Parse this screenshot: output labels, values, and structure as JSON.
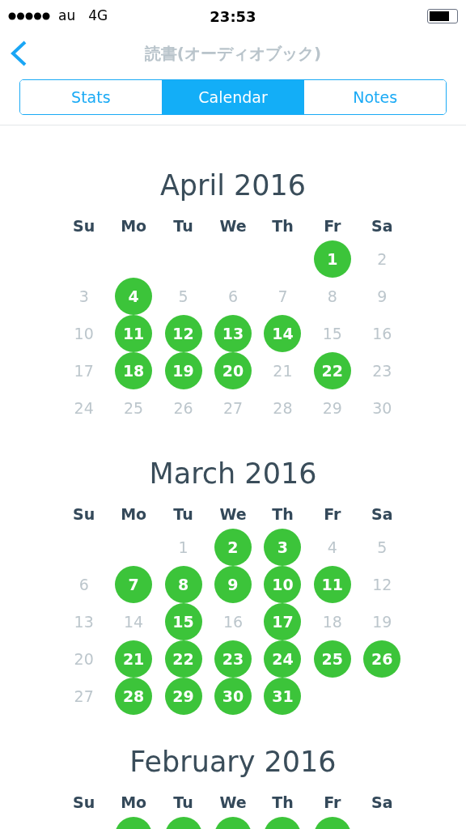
{
  "status_bar": {
    "carrier": "au",
    "network": "4G",
    "time": "23:53"
  },
  "nav": {
    "title": "読書(オーディオブック)"
  },
  "tabs": [
    {
      "label": "Stats",
      "selected": false
    },
    {
      "label": "Calendar",
      "selected": true
    },
    {
      "label": "Notes",
      "selected": false
    }
  ],
  "months": [
    {
      "title": "April 2016",
      "weekdays": [
        "Su",
        "Mo",
        "Tu",
        "We",
        "Th",
        "Fr",
        "Sa"
      ],
      "weeks": [
        [
          {
            "kind": "blank"
          },
          {
            "kind": "blank"
          },
          {
            "kind": "blank"
          },
          {
            "kind": "blank"
          },
          {
            "kind": "blank"
          },
          {
            "kind": "day",
            "day": "1",
            "marked": true
          },
          {
            "kind": "day",
            "day": "2",
            "marked": false
          }
        ],
        [
          {
            "kind": "day",
            "day": "3",
            "marked": false
          },
          {
            "kind": "day",
            "day": "4",
            "marked": true
          },
          {
            "kind": "day",
            "day": "5",
            "marked": false
          },
          {
            "kind": "day",
            "day": "6",
            "marked": false
          },
          {
            "kind": "day",
            "day": "7",
            "marked": false
          },
          {
            "kind": "day",
            "day": "8",
            "marked": false
          },
          {
            "kind": "day",
            "day": "9",
            "marked": false
          }
        ],
        [
          {
            "kind": "day",
            "day": "10",
            "marked": false
          },
          {
            "kind": "day",
            "day": "11",
            "marked": true
          },
          {
            "kind": "day",
            "day": "12",
            "marked": true
          },
          {
            "kind": "day",
            "day": "13",
            "marked": true
          },
          {
            "kind": "day",
            "day": "14",
            "marked": true
          },
          {
            "kind": "day",
            "day": "15",
            "marked": false
          },
          {
            "kind": "day",
            "day": "16",
            "marked": false
          }
        ],
        [
          {
            "kind": "day",
            "day": "17",
            "marked": false
          },
          {
            "kind": "day",
            "day": "18",
            "marked": true
          },
          {
            "kind": "day",
            "day": "19",
            "marked": true
          },
          {
            "kind": "day",
            "day": "20",
            "marked": true
          },
          {
            "kind": "day",
            "day": "21",
            "marked": false
          },
          {
            "kind": "day",
            "day": "22",
            "marked": true
          },
          {
            "kind": "day",
            "day": "23",
            "marked": false
          }
        ],
        [
          {
            "kind": "day",
            "day": "24",
            "marked": false
          },
          {
            "kind": "day",
            "day": "25",
            "marked": false
          },
          {
            "kind": "day",
            "day": "26",
            "marked": false
          },
          {
            "kind": "day",
            "day": "27",
            "marked": false
          },
          {
            "kind": "day",
            "day": "28",
            "marked": false
          },
          {
            "kind": "day",
            "day": "29",
            "marked": false
          },
          {
            "kind": "day",
            "day": "30",
            "marked": false
          }
        ]
      ]
    },
    {
      "title": "March 2016",
      "weekdays": [
        "Su",
        "Mo",
        "Tu",
        "We",
        "Th",
        "Fr",
        "Sa"
      ],
      "weeks": [
        [
          {
            "kind": "blank"
          },
          {
            "kind": "blank"
          },
          {
            "kind": "day",
            "day": "1",
            "marked": false
          },
          {
            "kind": "day",
            "day": "2",
            "marked": true
          },
          {
            "kind": "day",
            "day": "3",
            "marked": true
          },
          {
            "kind": "day",
            "day": "4",
            "marked": false
          },
          {
            "kind": "day",
            "day": "5",
            "marked": false
          }
        ],
        [
          {
            "kind": "day",
            "day": "6",
            "marked": false
          },
          {
            "kind": "day",
            "day": "7",
            "marked": true
          },
          {
            "kind": "day",
            "day": "8",
            "marked": true
          },
          {
            "kind": "day",
            "day": "9",
            "marked": true
          },
          {
            "kind": "day",
            "day": "10",
            "marked": true
          },
          {
            "kind": "day",
            "day": "11",
            "marked": true
          },
          {
            "kind": "day",
            "day": "12",
            "marked": false
          }
        ],
        [
          {
            "kind": "day",
            "day": "13",
            "marked": false
          },
          {
            "kind": "day",
            "day": "14",
            "marked": false
          },
          {
            "kind": "day",
            "day": "15",
            "marked": true
          },
          {
            "kind": "day",
            "day": "16",
            "marked": false
          },
          {
            "kind": "day",
            "day": "17",
            "marked": true
          },
          {
            "kind": "day",
            "day": "18",
            "marked": false
          },
          {
            "kind": "day",
            "day": "19",
            "marked": false
          }
        ],
        [
          {
            "kind": "day",
            "day": "20",
            "marked": false
          },
          {
            "kind": "day",
            "day": "21",
            "marked": true
          },
          {
            "kind": "day",
            "day": "22",
            "marked": true
          },
          {
            "kind": "day",
            "day": "23",
            "marked": true
          },
          {
            "kind": "day",
            "day": "24",
            "marked": true
          },
          {
            "kind": "day",
            "day": "25",
            "marked": true
          },
          {
            "kind": "day",
            "day": "26",
            "marked": true
          }
        ],
        [
          {
            "kind": "day",
            "day": "27",
            "marked": false
          },
          {
            "kind": "day",
            "day": "28",
            "marked": true
          },
          {
            "kind": "day",
            "day": "29",
            "marked": true
          },
          {
            "kind": "day",
            "day": "30",
            "marked": true
          },
          {
            "kind": "day",
            "day": "31",
            "marked": true
          },
          {
            "kind": "blank"
          },
          {
            "kind": "blank"
          }
        ]
      ]
    },
    {
      "title": "February 2016",
      "weekdays": [
        "Su",
        "Mo",
        "Tu",
        "We",
        "Th",
        "Fr",
        "Sa"
      ],
      "weeks": [
        [
          {
            "kind": "blank"
          },
          {
            "kind": "day",
            "marked": true
          },
          {
            "kind": "day",
            "marked": true
          },
          {
            "kind": "day",
            "marked": true
          },
          {
            "kind": "day",
            "marked": true
          },
          {
            "kind": "day",
            "marked": true
          },
          {
            "kind": "blank"
          }
        ]
      ]
    }
  ]
}
